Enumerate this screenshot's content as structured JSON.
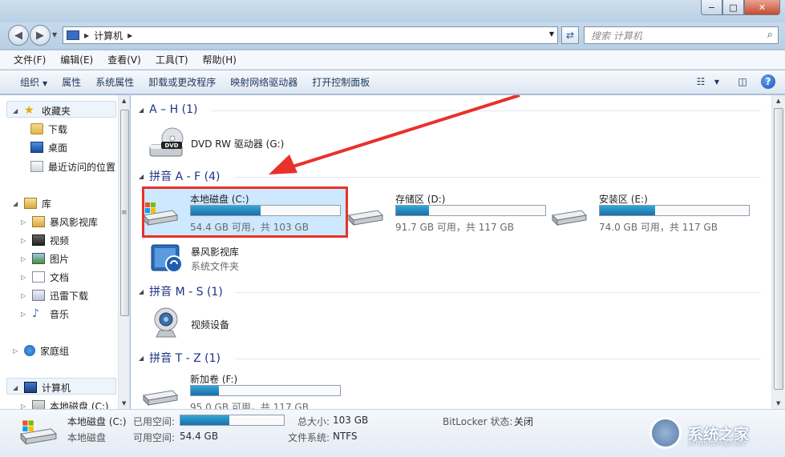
{
  "window": {
    "minimize_symbol": "−",
    "maximize_symbol": "□",
    "close_symbol": "✕"
  },
  "address": {
    "location": "计算机",
    "search_placeholder": "搜索 计算机"
  },
  "menu": [
    "文件(F)",
    "编辑(E)",
    "查看(V)",
    "工具(T)",
    "帮助(H)"
  ],
  "toolbar": {
    "organize": "组织",
    "properties": "属性",
    "system_properties": "系统属性",
    "uninstall": "卸载或更改程序",
    "map_drive": "映射网络驱动器",
    "control_panel": "打开控制面板"
  },
  "sidebar": {
    "favorites": "收藏夹",
    "downloads": "下载",
    "desktop": "桌面",
    "recent": "最近访问的位置",
    "libraries": "库",
    "baofeng": "暴风影视库",
    "videos": "视频",
    "pictures": "图片",
    "documents": "文档",
    "xunlei": "迅雷下载",
    "music": "音乐",
    "homegroup": "家庭组",
    "computer": "计算机",
    "local_disk": "本地磁盘 (C:)"
  },
  "groups": {
    "ah": "A – H (1)",
    "af": "拼音 A - F (4)",
    "ms": "拼音 M - S (1)",
    "tz": "拼音 T - Z (1)"
  },
  "items": {
    "dvd": {
      "name": "DVD RW 驱动器 (G:)",
      "badge": "DVD"
    },
    "c": {
      "name": "本地磁盘 (C:)",
      "free": "54.4 GB 可用，共 103 GB",
      "used_fraction": 0.47
    },
    "d": {
      "name": "存储区 (D:)",
      "free": "91.7 GB 可用，共 117 GB",
      "used_fraction": 0.22
    },
    "e": {
      "name": "安装区 (E:)",
      "free": "74.0 GB 可用，共 117 GB",
      "used_fraction": 0.37
    },
    "baofeng": {
      "name": "暴风影视库",
      "type": "系统文件夹"
    },
    "camera": {
      "name": "视频设备"
    },
    "f": {
      "name": "新加卷 (F:)",
      "free": "95.0 GB 可用，共 117 GB",
      "used_fraction": 0.19
    }
  },
  "details": {
    "name": "本地磁盘 (C:)",
    "type": "本地磁盘",
    "used_label": "已用空间:",
    "used_fraction": 0.47,
    "free_label": "可用空间:",
    "free_value": "54.4 GB",
    "total_label": "总大小:",
    "total_value": "103 GB",
    "fs_label": "文件系统:",
    "fs_value": "NTFS",
    "bitlocker_label": "BitLocker 状态:",
    "bitlocker_value": "关闭"
  },
  "watermark": {
    "text": "系统之家",
    "sub": "XITONGZHIJIA.NET"
  },
  "colors": {
    "accent": "#e8312b",
    "progress": "#1c8fc4",
    "selection": "#cde8ff",
    "group_header": "#1e3287"
  }
}
